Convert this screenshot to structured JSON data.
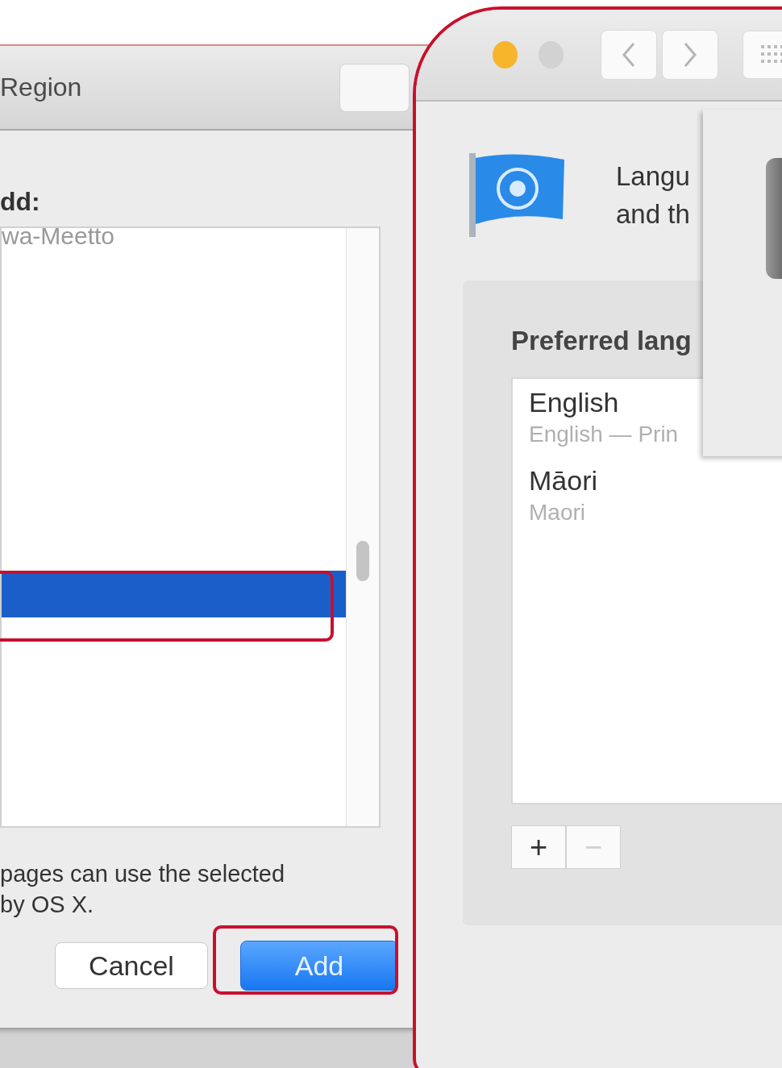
{
  "region_dialog": {
    "title": "Region",
    "list_label": "dd:",
    "list_rows": [
      {
        "label": "wa-Meetto",
        "selected": false
      },
      {
        "selected": true
      }
    ],
    "note_lines": [
      "pages can use the selected",
      "by OS X."
    ],
    "buttons": [
      {
        "label": "Cancel",
        "kind": "default"
      },
      {
        "label": "Add",
        "kind": "primary"
      }
    ]
  },
  "prefs_window": {
    "window_controls": [
      {
        "color": "#f7b52c"
      },
      {
        "color": "#d2d2d2"
      }
    ],
    "header_lines": [
      "Langu",
      "and th"
    ],
    "preferred_label": "Preferred lang",
    "languages": [
      {
        "name": "English",
        "detail": "English — Prin"
      },
      {
        "name": "Māori",
        "detail": "Maori"
      }
    ],
    "list_buttons": [
      {
        "label": "+",
        "disabled": false
      },
      {
        "label": "−",
        "disabled": true
      }
    ]
  }
}
